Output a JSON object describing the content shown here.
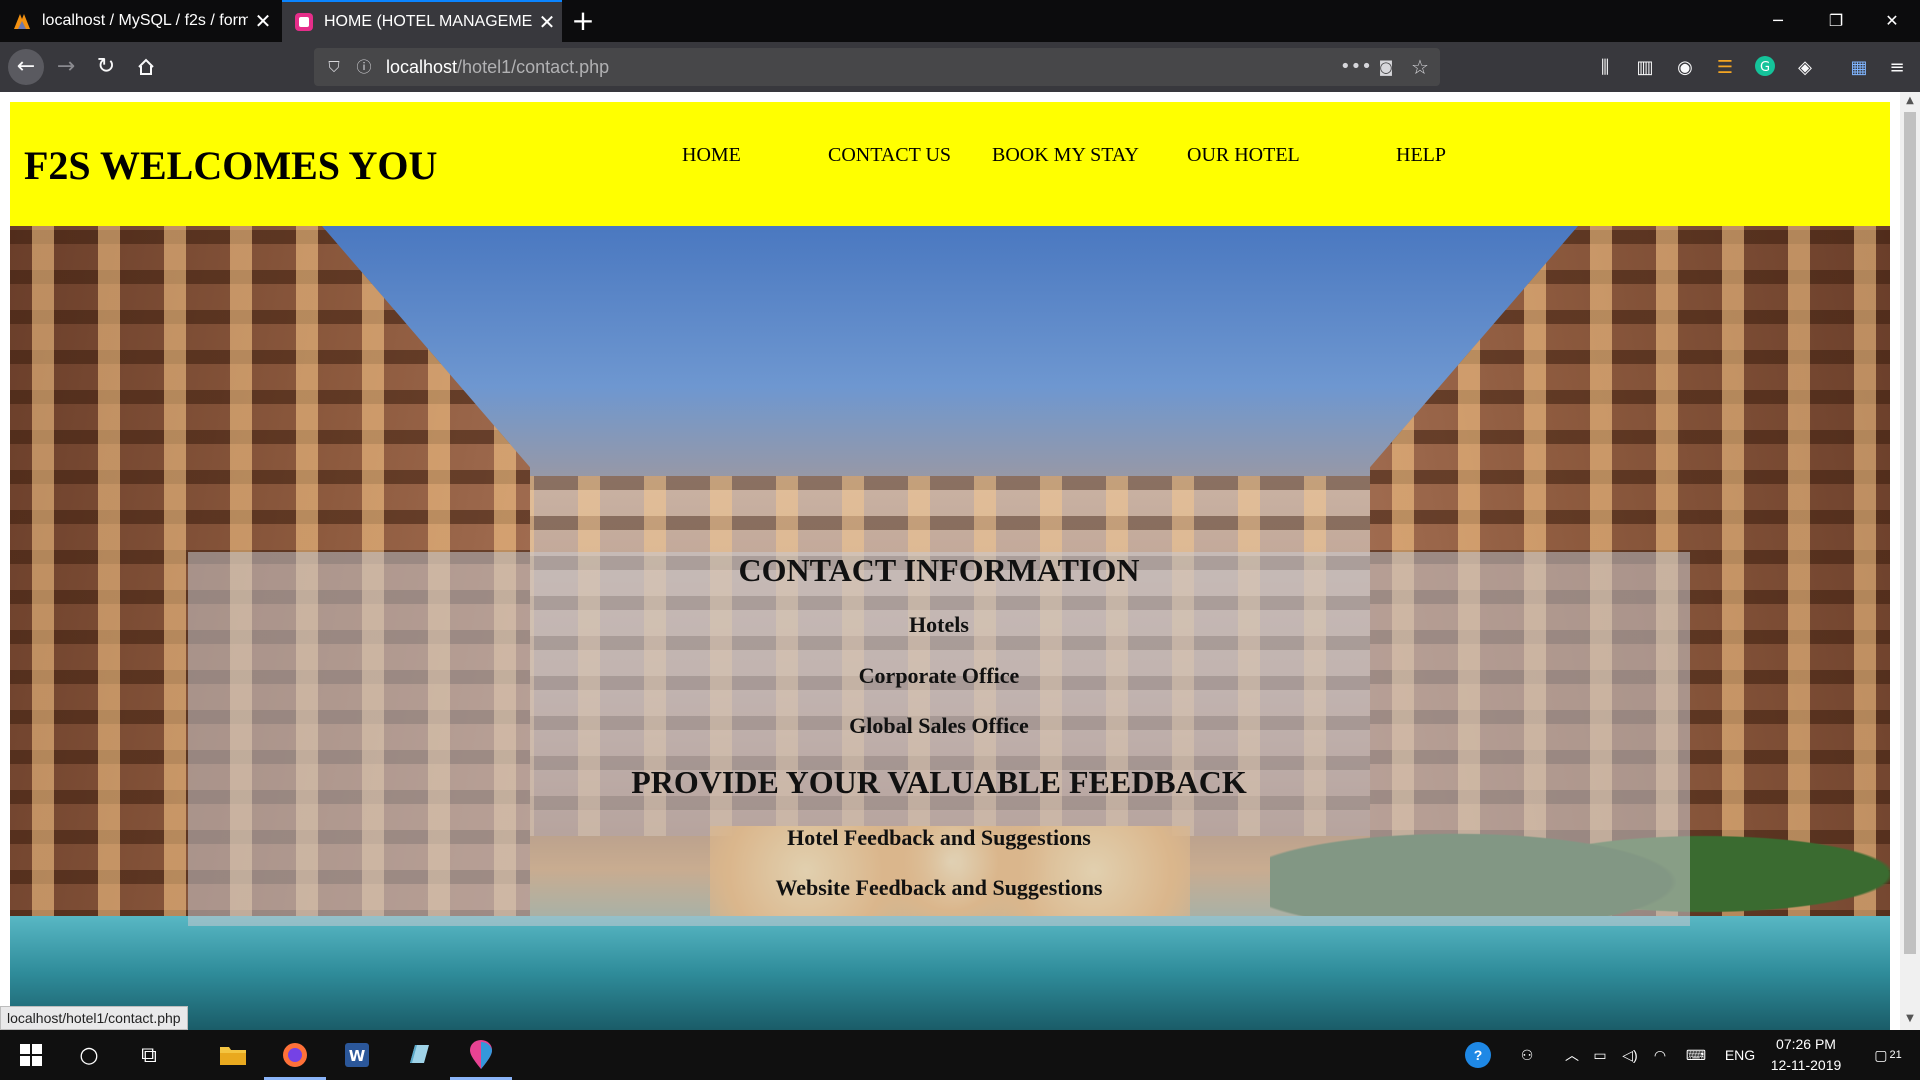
{
  "browser": {
    "tabs": [
      {
        "title": "localhost / MySQL / f2s / form",
        "close": "✕"
      },
      {
        "title": "HOME (HOTEL MANAGEMENT)",
        "close": "✕"
      }
    ],
    "new_tab": "+",
    "window_controls": {
      "minimize": "─",
      "restore": "❐",
      "close": "✕"
    },
    "url_host": "localhost",
    "url_path": "/hotel1/contact.php",
    "status_url": "localhost/hotel1/contact.php"
  },
  "site": {
    "brand": "F2S WELCOMES YOU",
    "menu": [
      "HOME",
      "CONTACT US",
      "BOOK MY STAY",
      "OUR HOTEL",
      "HELP"
    ]
  },
  "contact": {
    "heading": "CONTACT INFORMATION",
    "items": [
      "Hotels",
      "Corporate Office",
      "Global Sales Office"
    ],
    "feedback_heading": "PROVIDE YOUR VALUABLE FEEDBACK",
    "feedback_items": [
      "Hotel Feedback and Suggestions",
      "Website Feedback and Suggestions"
    ]
  },
  "taskbar": {
    "language": "ENG",
    "time": "07:26 PM",
    "date": "12-11-2019",
    "notifications": "21",
    "word_label": "W"
  },
  "colors": {
    "header": "#ffff00",
    "accent": "#0a84ff"
  }
}
